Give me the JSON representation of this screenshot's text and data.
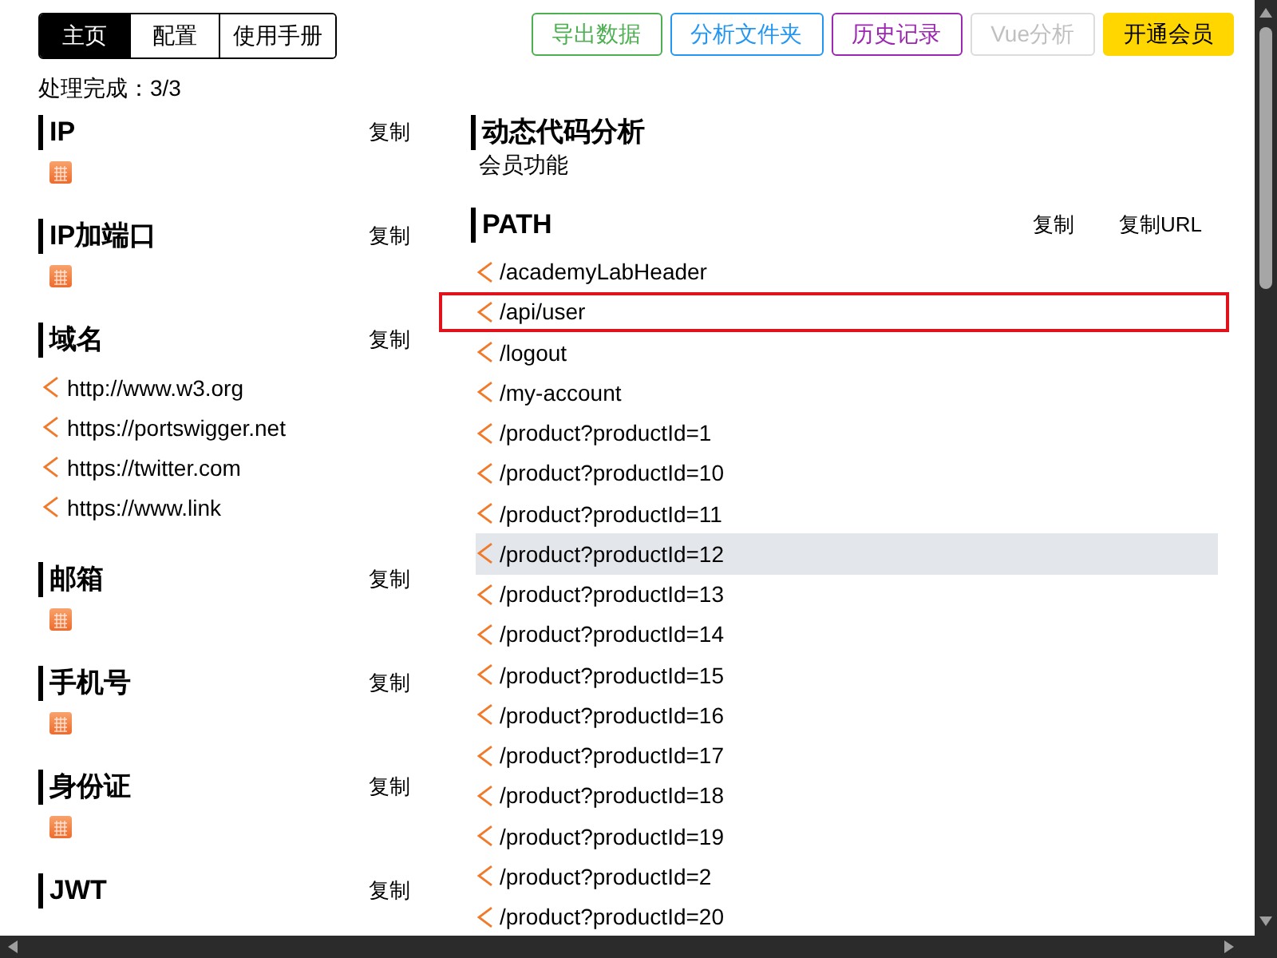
{
  "tabs": [
    {
      "label": "主页",
      "selected": true
    },
    {
      "label": "配置",
      "selected": false
    },
    {
      "label": "使用手册",
      "selected": false
    }
  ],
  "toolbar_buttons": [
    {
      "label": "导出数据",
      "kind": "outline",
      "color": "#4caf50",
      "disabled": false
    },
    {
      "label": "分析文件夹",
      "kind": "outline",
      "color": "#2196f3",
      "disabled": false
    },
    {
      "label": "历史记录",
      "kind": "outline",
      "color": "#9c27b0",
      "disabled": false
    },
    {
      "label": "Vue分析",
      "kind": "outline",
      "color": "#dcdcdc",
      "disabled": true
    },
    {
      "label": "开通会员",
      "kind": "filled",
      "color": "#ffd600",
      "disabled": false
    }
  ],
  "status": "处理完成：3/3",
  "left_sections": [
    {
      "title": "IP",
      "copy_label": "复制",
      "kind": "empty"
    },
    {
      "title": "IP加端口",
      "copy_label": "复制",
      "kind": "empty"
    },
    {
      "title": "域名",
      "copy_label": "复制",
      "kind": "list",
      "items": [
        "http://www.w3.org",
        "https://portswigger.net",
        "https://twitter.com",
        "https://www.link"
      ]
    },
    {
      "title": "邮箱",
      "copy_label": "复制",
      "kind": "empty"
    },
    {
      "title": "手机号",
      "copy_label": "复制",
      "kind": "empty"
    },
    {
      "title": "身份证",
      "copy_label": "复制",
      "kind": "empty"
    },
    {
      "title": "JWT",
      "copy_label": "复制"
    }
  ],
  "dynamic_analysis": {
    "title": "动态代码分析",
    "note": "会员功能"
  },
  "path": {
    "title": "PATH",
    "actions": [
      "复制",
      "复制URL"
    ],
    "items": [
      {
        "text": "/academyLabHeader",
        "selected": false,
        "hovered": false
      },
      {
        "text": "/api/user",
        "selected": true,
        "hovered": false
      },
      {
        "text": "/logout",
        "selected": false,
        "hovered": false
      },
      {
        "text": "/my-account",
        "selected": false,
        "hovered": false
      },
      {
        "text": "/product?productId=1",
        "selected": false,
        "hovered": false
      },
      {
        "text": "/product?productId=10",
        "selected": false,
        "hovered": false
      },
      {
        "text": "/product?productId=11",
        "selected": false,
        "hovered": false
      },
      {
        "text": "/product?productId=12",
        "selected": false,
        "hovered": true
      },
      {
        "text": "/product?productId=13",
        "selected": false,
        "hovered": false
      },
      {
        "text": "/product?productId=14",
        "selected": false,
        "hovered": false
      },
      {
        "text": "/product?productId=15",
        "selected": false,
        "hovered": false
      },
      {
        "text": "/product?productId=16",
        "selected": false,
        "hovered": false
      },
      {
        "text": "/product?productId=17",
        "selected": false,
        "hovered": false
      },
      {
        "text": "/product?productId=18",
        "selected": false,
        "hovered": false
      },
      {
        "text": "/product?productId=19",
        "selected": false,
        "hovered": false
      },
      {
        "text": "/product?productId=2",
        "selected": false,
        "hovered": false
      },
      {
        "text": "/product?productId=20",
        "selected": false,
        "hovered": false
      }
    ]
  }
}
